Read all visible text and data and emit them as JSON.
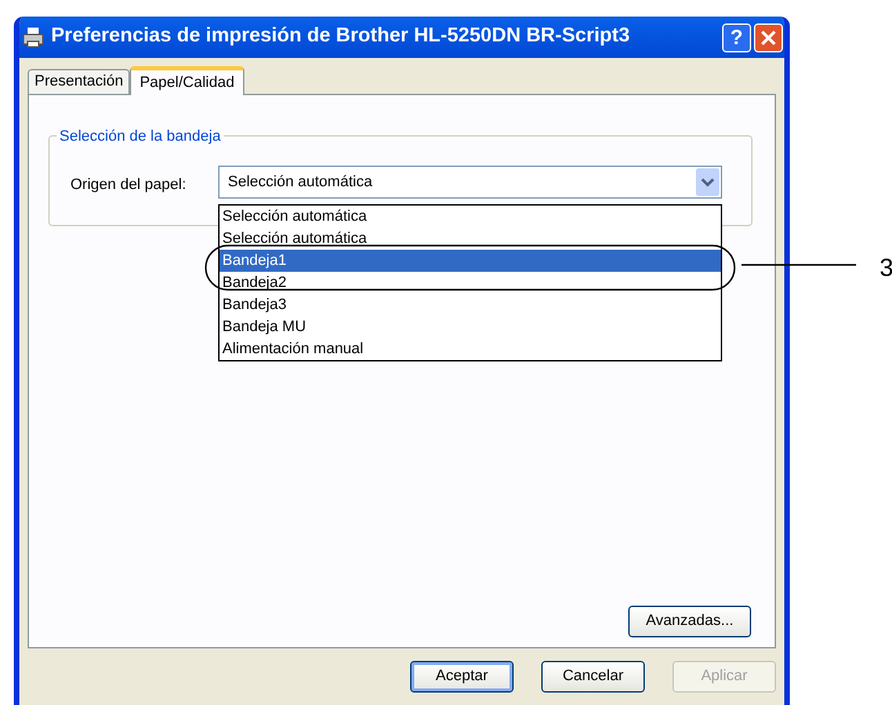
{
  "window": {
    "title": "Preferencias de impresión de Brother HL-5250DN BR-Script3",
    "title_buttons": [
      {
        "kind": "help",
        "label": "?"
      },
      {
        "kind": "close"
      }
    ]
  },
  "tabs": [
    {
      "label": "Presentación",
      "selected": false
    },
    {
      "label": "Papel/Calidad",
      "selected": true
    }
  ],
  "group": {
    "title": "Selección de la bandeja",
    "field_label": "Origen del papel:",
    "combo_value": "Selección automática",
    "options": [
      {
        "label": "Selección automática",
        "selected": false
      },
      {
        "label": "Selección automática",
        "selected": false
      },
      {
        "label": "Bandeja1",
        "selected": true
      },
      {
        "label": "Bandeja2",
        "selected": false
      },
      {
        "label": "Bandeja3",
        "selected": false
      },
      {
        "label": "Bandeja MU",
        "selected": false
      },
      {
        "label": "Alimentación manual",
        "selected": false
      }
    ]
  },
  "advanced_button": {
    "label": "Avanzadas...",
    "disabled": false
  },
  "buttons": [
    {
      "label": "Aceptar",
      "disabled": false,
      "default": true
    },
    {
      "label": "Cancelar",
      "disabled": false,
      "default": false
    },
    {
      "label": "Aplicar",
      "disabled": true,
      "default": false
    }
  ],
  "callout": {
    "label": "3"
  }
}
